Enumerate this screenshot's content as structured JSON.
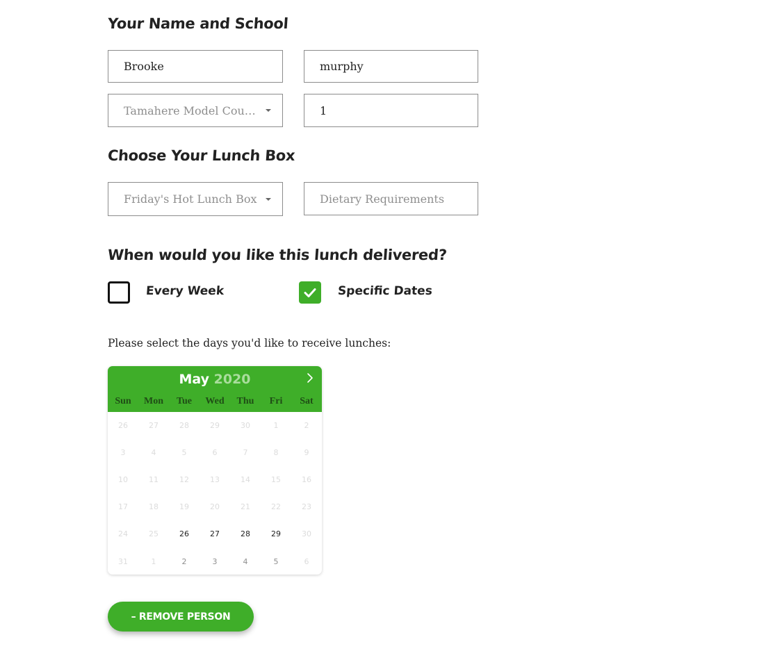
{
  "sections": {
    "name_school": "Your Name and School",
    "lunch_box": "Choose Your Lunch Box",
    "delivery": "When would you like this lunch delivered?"
  },
  "form": {
    "first_name": "Brooke",
    "last_name": "murphy",
    "school": "Tamahere Model Coun...",
    "room": "1",
    "lunch_box": "Friday's Hot Lunch Box",
    "dietary_placeholder": "Dietary Requirements"
  },
  "delivery": {
    "every_week": {
      "label": "Every Week",
      "checked": false
    },
    "specific_dates": {
      "label": "Specific Dates",
      "checked": true
    }
  },
  "prompt": "Please select the days you'd like to receive lunches:",
  "calendar": {
    "month": "May",
    "year": "2020",
    "next_icon": "chevron-right-icon",
    "weekdays": [
      "Sun",
      "Mon",
      "Tue",
      "Wed",
      "Thu",
      "Fri",
      "Sat"
    ],
    "weeks": [
      [
        {
          "d": "26",
          "s": "dis"
        },
        {
          "d": "27",
          "s": "dis"
        },
        {
          "d": "28",
          "s": "dis"
        },
        {
          "d": "29",
          "s": "dis"
        },
        {
          "d": "30",
          "s": "dis"
        },
        {
          "d": "1",
          "s": "dis"
        },
        {
          "d": "2",
          "s": "dis"
        }
      ],
      [
        {
          "d": "3",
          "s": "dis"
        },
        {
          "d": "4",
          "s": "dis"
        },
        {
          "d": "5",
          "s": "dis"
        },
        {
          "d": "6",
          "s": "dis"
        },
        {
          "d": "7",
          "s": "dis"
        },
        {
          "d": "8",
          "s": "dis"
        },
        {
          "d": "9",
          "s": "dis"
        }
      ],
      [
        {
          "d": "10",
          "s": "dis"
        },
        {
          "d": "11",
          "s": "dis"
        },
        {
          "d": "12",
          "s": "dis"
        },
        {
          "d": "13",
          "s": "dis"
        },
        {
          "d": "14",
          "s": "dis"
        },
        {
          "d": "15",
          "s": "dis"
        },
        {
          "d": "16",
          "s": "dis"
        }
      ],
      [
        {
          "d": "17",
          "s": "dis"
        },
        {
          "d": "18",
          "s": "dis"
        },
        {
          "d": "19",
          "s": "dis"
        },
        {
          "d": "20",
          "s": "dis"
        },
        {
          "d": "21",
          "s": "dis"
        },
        {
          "d": "22",
          "s": "dis"
        },
        {
          "d": "23",
          "s": "dis"
        }
      ],
      [
        {
          "d": "24",
          "s": "dis"
        },
        {
          "d": "25",
          "s": "dis"
        },
        {
          "d": "26",
          "s": "en"
        },
        {
          "d": "27",
          "s": "en"
        },
        {
          "d": "28",
          "s": "en"
        },
        {
          "d": "29",
          "s": "en"
        },
        {
          "d": "30",
          "s": "dis"
        }
      ],
      [
        {
          "d": "31",
          "s": "dis"
        },
        {
          "d": "1",
          "s": "dis"
        },
        {
          "d": "2",
          "s": "nx"
        },
        {
          "d": "3",
          "s": "nx"
        },
        {
          "d": "4",
          "s": "nx"
        },
        {
          "d": "5",
          "s": "nx"
        },
        {
          "d": "6",
          "s": "dis"
        }
      ]
    ]
  },
  "remove_button": "– REMOVE PERSON",
  "colors": {
    "accent": "#3fae29",
    "heading": "#222222"
  }
}
